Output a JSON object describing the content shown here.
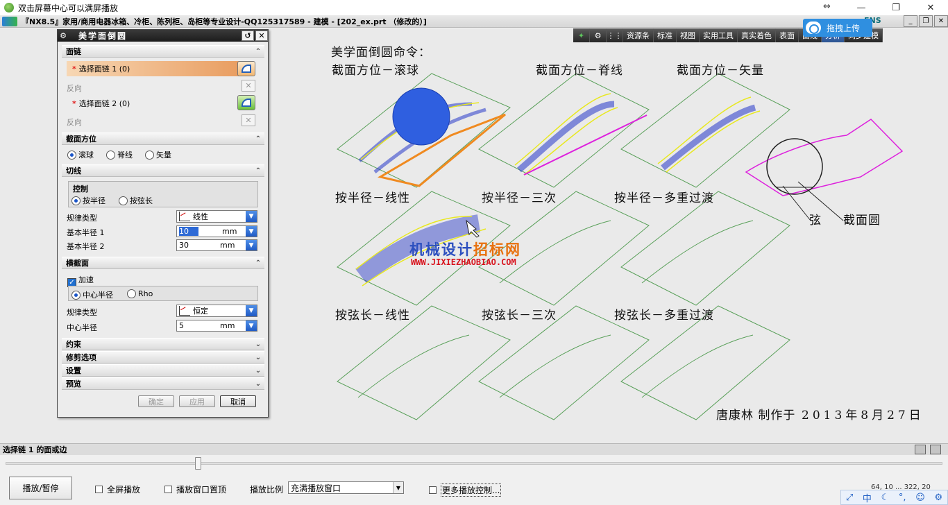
{
  "player": {
    "title": "双击屏幕中心可以满屏播放",
    "play_label": "播放/暂停",
    "fullscreen_label": "全屏播放",
    "ontop_label": "播放窗口置顶",
    "scale_label": "播放比例",
    "scale_value": "充满播放窗口",
    "more_label": "更多播放控制...",
    "coords": "64, 10 ... 322, 20",
    "seek_fraction": 0.205
  },
  "nx": {
    "title": "『NX8.5』家用/商用电器冰箱、冷柜、陈列柜、岛柜等专业设计-QQ125317589 - 建模 - [202_ex.prt （修改的）]",
    "brand": "ENS",
    "tabs": [
      "资源条",
      "标准",
      "视图",
      "实用工具",
      "真实着色",
      "表面",
      "曲线",
      "分析",
      "同步建模"
    ],
    "active_tab_index": 7
  },
  "upload": {
    "label": "拖拽上传"
  },
  "dialog": {
    "title": "美学面倒圆",
    "face_chain": {
      "header": "面链",
      "select1": "选择面链 1 (0)",
      "reverse1": "反向",
      "select2": "选择面链 2 (0)",
      "reverse2": "反向"
    },
    "section_orient": {
      "header": "截面方位",
      "options": [
        "滚球",
        "脊线",
        "矢量"
      ],
      "selected": 0
    },
    "tangent": {
      "header": "切线",
      "control_header": "控制",
      "control_options": [
        "按半径",
        "按弦长"
      ],
      "control_selected": 0,
      "law_label": "规律类型",
      "law_value": "线性",
      "radius1_label": "基本半径 1",
      "radius1_value": "10",
      "radius2_label": "基本半径 2",
      "radius2_value": "30",
      "unit": "mm"
    },
    "cross_section": {
      "header": "横截面",
      "accel_label": "加速",
      "options": [
        "中心半径",
        "Rho"
      ],
      "selected": 0,
      "law_label": "规律类型",
      "law_value": "恒定",
      "center_radius_label": "中心半径",
      "center_radius_value": "5",
      "unit": "mm"
    },
    "collapsed_sections": [
      "约束",
      "修剪选项",
      "设置",
      "预览"
    ],
    "ok": "确定",
    "apply": "应用",
    "cancel": "取消"
  },
  "graphics": {
    "heading": "美学面倒圆命令：",
    "labels": {
      "roll_ball": "截面方位－滚球",
      "spine": "截面方位－脊线",
      "vector": "截面方位－矢量",
      "radius_linear": "按半径－线性",
      "radius_cubic": "按半径－三次",
      "radius_multi": "按半径－多重过渡",
      "chord_linear": "按弦长－线性",
      "chord_cubic": "按弦长－三次",
      "chord_multi": "按弦长－多重过渡",
      "chord": "弦",
      "section_circle": "截面圆"
    },
    "author": "唐康林  制作于",
    "date": "2013年8月27日",
    "watermark_cn_a": "机械设计",
    "watermark_cn_b": "招标网",
    "watermark_url": "WWW.JIXIEZHAOBIAO.COM"
  },
  "status": {
    "prompt": "选择链 1 的面或边"
  },
  "tray": {
    "ime": "中"
  },
  "colors": {
    "surface_edge": "#5aa05a",
    "mesh": "#2436c8",
    "highlight": "#e8e820",
    "magenta": "#dd22dd",
    "orange": "#f08a20",
    "ball": "#2f5fe0"
  }
}
